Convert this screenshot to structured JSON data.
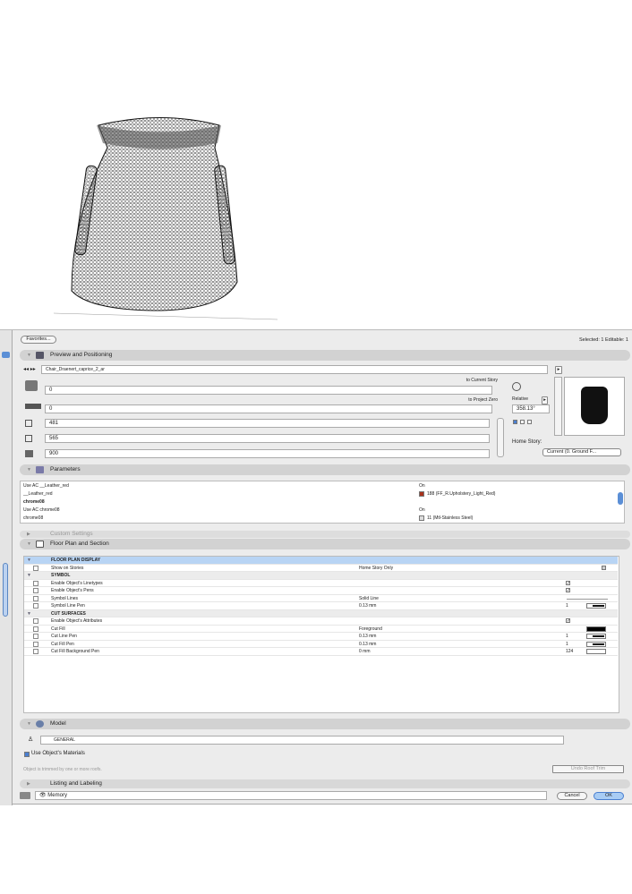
{
  "dialog": {
    "favorites_label": "Favorites...",
    "selection_info": "Selected: 1 Editable: 1",
    "preview": {
      "title": "Preview and Positioning",
      "object_name": "Chair_Draenert_caprice_2_ar",
      "to_current_story": "to Current Story",
      "to_project_zero": "to Project Zero",
      "elevation_story": "0",
      "elevation_zero": "0",
      "width": "481",
      "depth": "565",
      "height": "900",
      "rotation_mode": "Relative",
      "angle": "358.13°",
      "home_story_label": "Home Story:",
      "home_story_value": "Current (0. Ground F..."
    },
    "parameters": {
      "title": "Parameters",
      "rows": [
        {
          "name": "Use AC __Leather_red",
          "value": "On"
        },
        {
          "name": "__Leather_red",
          "value": "188 (FF_R.Upholstery_Light_Red)",
          "swatch": "#a8321c"
        },
        {
          "name": "chrome08",
          "value": ""
        },
        {
          "name": "Use AC chrome08",
          "value": "On"
        },
        {
          "name": "chrome08",
          "value": "11 (Mtl-Stainless Steel)",
          "swatch": "#dddddd"
        }
      ]
    },
    "custom_settings": {
      "title": "Custom Settings"
    },
    "floor_plan": {
      "title": "Floor Plan and Section",
      "rows": [
        {
          "label": "FLOOR PLAN DISPLAY",
          "value": "",
          "num": "",
          "group": true,
          "selected": true
        },
        {
          "label": "Show on Stories",
          "value": "Home Story Only",
          "num": ""
        },
        {
          "label": "SYMBOL",
          "value": "",
          "num": "",
          "group": true
        },
        {
          "label": "Enable Object's Linetypes",
          "value": "",
          "num": "",
          "check": true
        },
        {
          "label": "Enable Object's Pens",
          "value": "",
          "num": "",
          "check": true
        },
        {
          "label": "Symbol Lines",
          "value": "Solid Line",
          "num": ""
        },
        {
          "label": "Symbol Line Pen",
          "value": "0.13 mm",
          "num": "1",
          "pen": true
        },
        {
          "label": "CUT SURFACES",
          "value": "",
          "num": "",
          "group": true
        },
        {
          "label": "Enable Object's Attributes",
          "value": "",
          "num": "",
          "check": true
        },
        {
          "label": "Cut Fill",
          "value": "Foreground",
          "num": "",
          "fill": true
        },
        {
          "label": "Cut Line Pen",
          "value": "0.13 mm",
          "num": "1",
          "pen": true
        },
        {
          "label": "Cut Fill Pen",
          "value": "0.13 mm",
          "num": "1",
          "pen": true
        },
        {
          "label": "Cut Fill Background Pen",
          "value": "0 mm",
          "num": "124",
          "blank": true
        }
      ]
    },
    "model": {
      "title": "Model",
      "material": "GENERAL",
      "use_materials": "Use Object's Materials",
      "trim_note": "Object is trimmed by one or more roofs.",
      "undo_roof_trim": "Undo Roof Trim"
    },
    "listing": {
      "title": "Listing and Labeling"
    },
    "layer": "Memory",
    "cancel": "Cancel",
    "ok": "OK"
  }
}
